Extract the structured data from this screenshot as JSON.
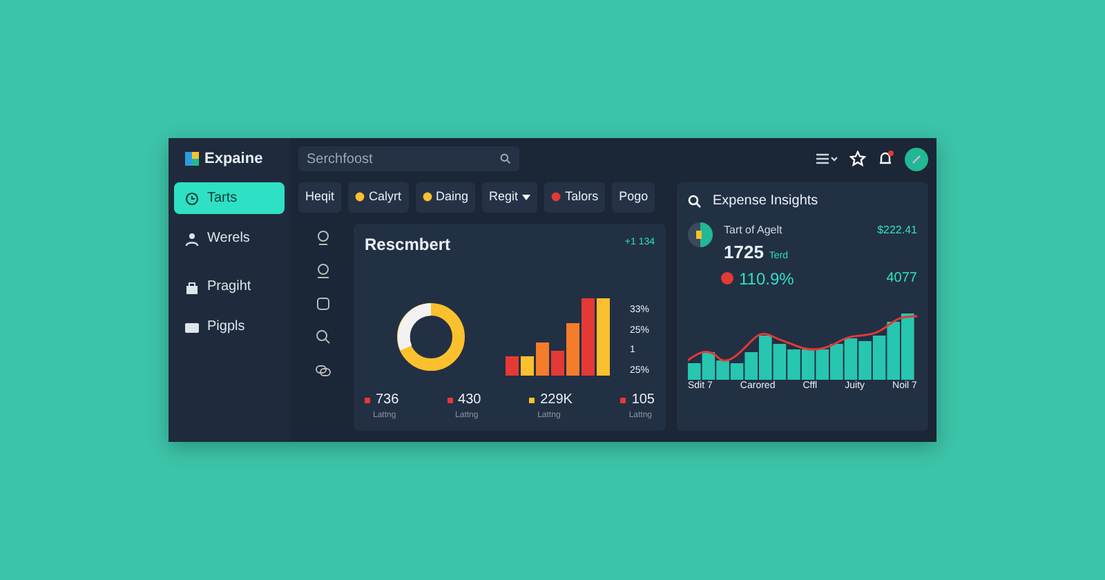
{
  "app": {
    "logo": "Expaine",
    "search": {
      "placeholder": "Serchfoost"
    }
  },
  "sidebar": {
    "items": [
      {
        "label": "Tarts",
        "selected": true
      },
      {
        "label": "Werels",
        "selected": false
      },
      {
        "label": "Pragiht",
        "selected": false
      },
      {
        "label": "Pigpls",
        "selected": false
      }
    ]
  },
  "toolbar": {
    "notification": true
  },
  "tabs": [
    {
      "label": "Heqit",
      "kind": "plain"
    },
    {
      "label": "Calyrt",
      "kind": "icon"
    },
    {
      "label": "Daing",
      "kind": "icon"
    },
    {
      "label": "Regit",
      "kind": "dropdown"
    },
    {
      "label": "Talors",
      "kind": "icon"
    },
    {
      "label": "Pogo",
      "kind": "plain"
    }
  ],
  "summary_card": {
    "title": "Rescmbert",
    "trend": "+1 134",
    "side_labels": [
      "33%",
      "25%",
      "1",
      "25%"
    ],
    "legend": [
      {
        "value": "736",
        "label": "Lattng",
        "color": "#e53935"
      },
      {
        "value": "430",
        "label": "Lattng",
        "color": "#e53935"
      },
      {
        "value": "229K",
        "label": "Lattng",
        "color": "#fbc02d"
      },
      {
        "value": "105",
        "label": "Lattng",
        "color": "#e53935"
      }
    ]
  },
  "insights": {
    "title": "Expense Insights",
    "metric_label": "Tart of Agelt",
    "metric_value": "1725",
    "metric_unit": "Terd",
    "amount": "$222.41",
    "change": "110.9%",
    "count": "4077",
    "x_labels": [
      "Sdit 7",
      "Carored",
      "Cffl",
      "Juity",
      "Noil 7"
    ]
  }
}
